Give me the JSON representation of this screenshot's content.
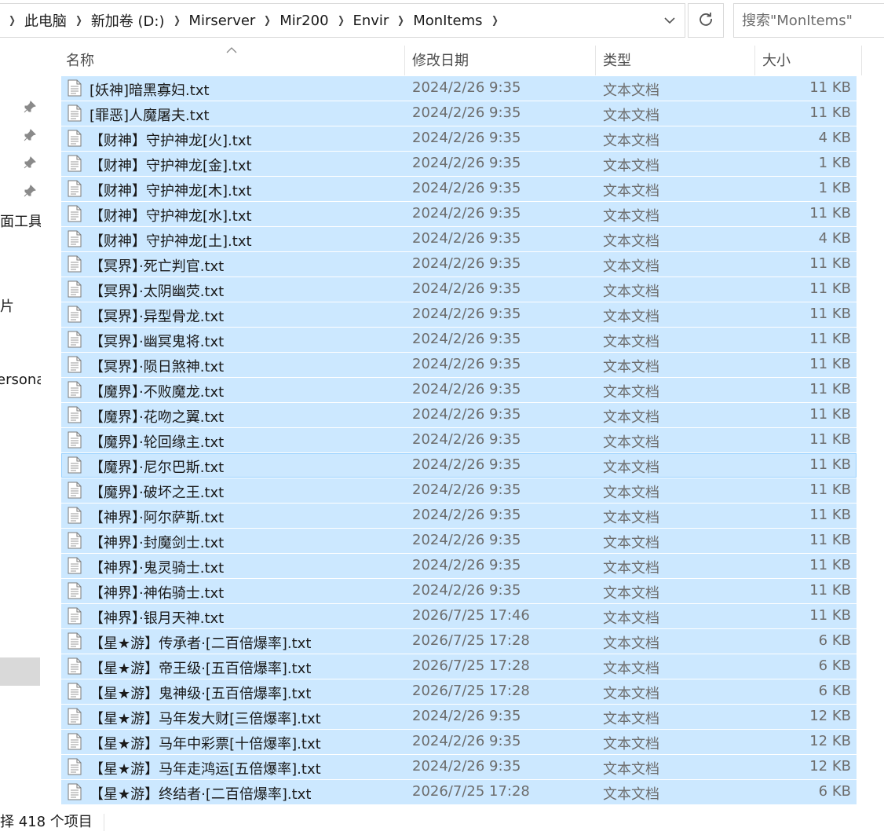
{
  "breadcrumbs": [
    "此电脑",
    "新加卷 (D:)",
    "Mirserver",
    "Mir200",
    "Envir",
    "MonItems"
  ],
  "search": {
    "placeholder": "搜索\"MonItems\""
  },
  "nav": {
    "labels": [
      "面工具",
      "片",
      "ersonal"
    ]
  },
  "columns": {
    "name": "名称",
    "date": "修改日期",
    "type": "类型",
    "size": "大小"
  },
  "files": [
    {
      "name": "[妖神]暗黑寡妇.txt",
      "date": "2024/2/26 9:35",
      "type": "文本文档",
      "size": "11 KB"
    },
    {
      "name": "[罪恶]人魔屠夫.txt",
      "date": "2024/2/26 9:35",
      "type": "文本文档",
      "size": "11 KB"
    },
    {
      "name": "【财神】守护神龙[火].txt",
      "date": "2024/2/26 9:35",
      "type": "文本文档",
      "size": "4 KB"
    },
    {
      "name": "【财神】守护神龙[金].txt",
      "date": "2024/2/26 9:35",
      "type": "文本文档",
      "size": "1 KB"
    },
    {
      "name": "【财神】守护神龙[木].txt",
      "date": "2024/2/26 9:35",
      "type": "文本文档",
      "size": "1 KB"
    },
    {
      "name": "【财神】守护神龙[水].txt",
      "date": "2024/2/26 9:35",
      "type": "文本文档",
      "size": "11 KB"
    },
    {
      "name": "【财神】守护神龙[土].txt",
      "date": "2024/2/26 9:35",
      "type": "文本文档",
      "size": "4 KB"
    },
    {
      "name": "【冥界】·死亡判官.txt",
      "date": "2024/2/26 9:35",
      "type": "文本文档",
      "size": "11 KB"
    },
    {
      "name": "【冥界】·太阴幽荧.txt",
      "date": "2024/2/26 9:35",
      "type": "文本文档",
      "size": "11 KB"
    },
    {
      "name": "【冥界】·异型骨龙.txt",
      "date": "2024/2/26 9:35",
      "type": "文本文档",
      "size": "11 KB"
    },
    {
      "name": "【冥界】·幽冥鬼将.txt",
      "date": "2024/2/26 9:35",
      "type": "文本文档",
      "size": "11 KB"
    },
    {
      "name": "【冥界】·陨日煞神.txt",
      "date": "2024/2/26 9:35",
      "type": "文本文档",
      "size": "11 KB"
    },
    {
      "name": "【魔界】·不败魔龙.txt",
      "date": "2024/2/26 9:35",
      "type": "文本文档",
      "size": "11 KB"
    },
    {
      "name": "【魔界】·花吻之翼.txt",
      "date": "2024/2/26 9:35",
      "type": "文本文档",
      "size": "11 KB"
    },
    {
      "name": "【魔界】·轮回缘主.txt",
      "date": "2024/2/26 9:35",
      "type": "文本文档",
      "size": "11 KB"
    },
    {
      "name": "【魔界】·尼尔巴斯.txt",
      "date": "2024/2/26 9:35",
      "type": "文本文档",
      "size": "11 KB"
    },
    {
      "name": "【魔界】·破坏之王.txt",
      "date": "2024/2/26 9:35",
      "type": "文本文档",
      "size": "11 KB"
    },
    {
      "name": "【神界】·阿尔萨斯.txt",
      "date": "2024/2/26 9:35",
      "type": "文本文档",
      "size": "11 KB"
    },
    {
      "name": "【神界】·封魔剑士.txt",
      "date": "2024/2/26 9:35",
      "type": "文本文档",
      "size": "11 KB"
    },
    {
      "name": "【神界】·鬼灵骑士.txt",
      "date": "2024/2/26 9:35",
      "type": "文本文档",
      "size": "11 KB"
    },
    {
      "name": "【神界】·神佑骑士.txt",
      "date": "2024/2/26 9:35",
      "type": "文本文档",
      "size": "11 KB"
    },
    {
      "name": "【神界】·银月天神.txt",
      "date": "2026/7/25 17:46",
      "type": "文本文档",
      "size": "11 KB"
    },
    {
      "name": "【星★游】传承者·[二百倍爆率].txt",
      "date": "2026/7/25 17:28",
      "type": "文本文档",
      "size": "6 KB"
    },
    {
      "name": "【星★游】帝王级·[五百倍爆率].txt",
      "date": "2026/7/25 17:28",
      "type": "文本文档",
      "size": "6 KB"
    },
    {
      "name": "【星★游】鬼神级·[五百倍爆率].txt",
      "date": "2026/7/25 17:28",
      "type": "文本文档",
      "size": "6 KB"
    },
    {
      "name": "【星★游】马年发大财[三倍爆率].txt",
      "date": "2024/2/26 9:35",
      "type": "文本文档",
      "size": "12 KB"
    },
    {
      "name": "【星★游】马年中彩票[十倍爆率].txt",
      "date": "2024/2/26 9:35",
      "type": "文本文档",
      "size": "12 KB"
    },
    {
      "name": "【星★游】马年走鸿运[五倍爆率].txt",
      "date": "2024/2/26 9:35",
      "type": "文本文档",
      "size": "12 KB"
    },
    {
      "name": "【星★游】终结者·[二百倍爆率].txt",
      "date": "2026/7/25 17:28",
      "type": "文本文档",
      "size": "6 KB"
    }
  ],
  "status": {
    "text": "择 418 个项目"
  },
  "colors": {
    "selection": "#cce8ff",
    "focus_border": "#99d1ff",
    "muted_text": "#6d6d6d"
  },
  "icons": {
    "breadcrumb_separator": "chevron-right-icon",
    "address_dropdown": "chevron-down-icon",
    "refresh": "refresh-icon",
    "pin": "pin-icon",
    "file": "text-file-icon",
    "sort": "sort-up-icon"
  }
}
